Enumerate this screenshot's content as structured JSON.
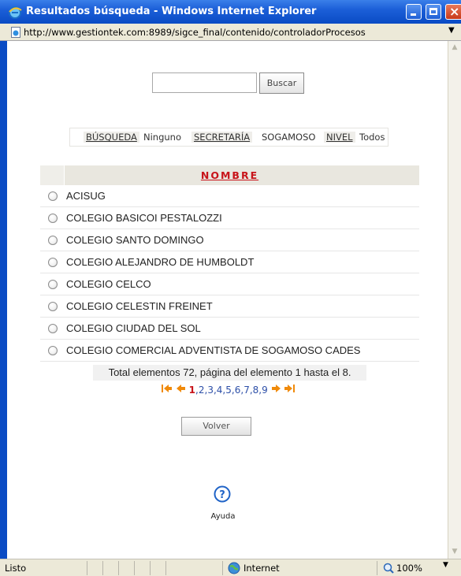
{
  "window": {
    "title": "Resultados búsqueda - Windows Internet Explorer",
    "url": "http://www.gestiontek.com:8989/sigce_final/contenido/controladorProcesos"
  },
  "search": {
    "value": "",
    "button_label": "Buscar"
  },
  "filters": [
    {
      "label": "BÚSQUEDA",
      "value": "Ninguno"
    },
    {
      "label": "SECRETARÍA",
      "value": "SOGAMOSO"
    },
    {
      "label": "NIVEL",
      "value": "Todos"
    }
  ],
  "table": {
    "column_header": "NOMBRE",
    "rows": [
      "ACISUG",
      "COLEGIO BASICOI PESTALOZZI",
      "COLEGIO SANTO DOMINGO",
      "COLEGIO ALEJANDRO DE HUMBOLDT",
      "COLEGIO CELCO",
      "COLEGIO CELESTIN FREINET",
      "COLEGIO CIUDAD DEL SOL",
      "COLEGIO COMERCIAL ADVENTISTA DE SOGAMOSO CADES"
    ]
  },
  "pagination": {
    "summary": "Total elementos 72, página del elemento 1 hasta el 8.",
    "current_page": "1",
    "pages": [
      "2",
      "3",
      "4",
      "5",
      "6",
      "7",
      "8",
      "9"
    ]
  },
  "back_button_label": "Volver",
  "help_label": "Ayuda",
  "statusbar": {
    "status": "Listo",
    "zone": "Internet",
    "zoom": "100%"
  },
  "colors": {
    "titlebar": "#0a4bc4",
    "header_text": "#c8141a",
    "pager_arrow": "#f08a0a",
    "help_icon": "#1f63c7"
  },
  "icons": [
    "ie-icon",
    "minimize-icon",
    "maximize-icon",
    "close-icon",
    "page-icon",
    "first-page-icon",
    "prev-page-icon",
    "next-page-icon",
    "last-page-icon",
    "help-icon",
    "globe-icon",
    "zoom-icon"
  ]
}
